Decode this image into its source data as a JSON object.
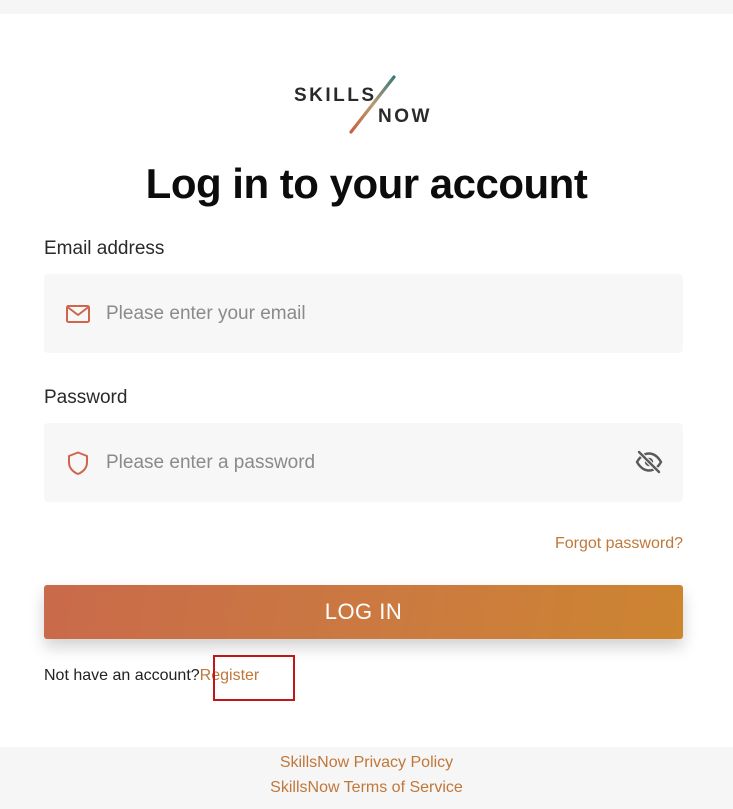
{
  "brand": {
    "logo_word_1": "SKILLS",
    "logo_word_2": "NOW",
    "accent_color": "#c0773a",
    "button_gradient": [
      "#c96a4a",
      "#cd8530"
    ]
  },
  "page": {
    "title": "Log in to your account"
  },
  "form": {
    "email": {
      "label": "Email address",
      "placeholder": "Please enter your email",
      "value": "",
      "icon": "mail-icon"
    },
    "password": {
      "label": "Password",
      "placeholder": "Please enter a password",
      "value": "",
      "icon": "shield-icon",
      "toggle_icon": "eye-off-icon"
    },
    "forgot_label": "Forgot password?",
    "submit_label": "LOG IN",
    "register_prompt": "Not have an account?",
    "register_label": "Register"
  },
  "footer": {
    "privacy_label": "SkillsNow Privacy Policy",
    "terms_label": "SkillsNow Terms of Service"
  }
}
